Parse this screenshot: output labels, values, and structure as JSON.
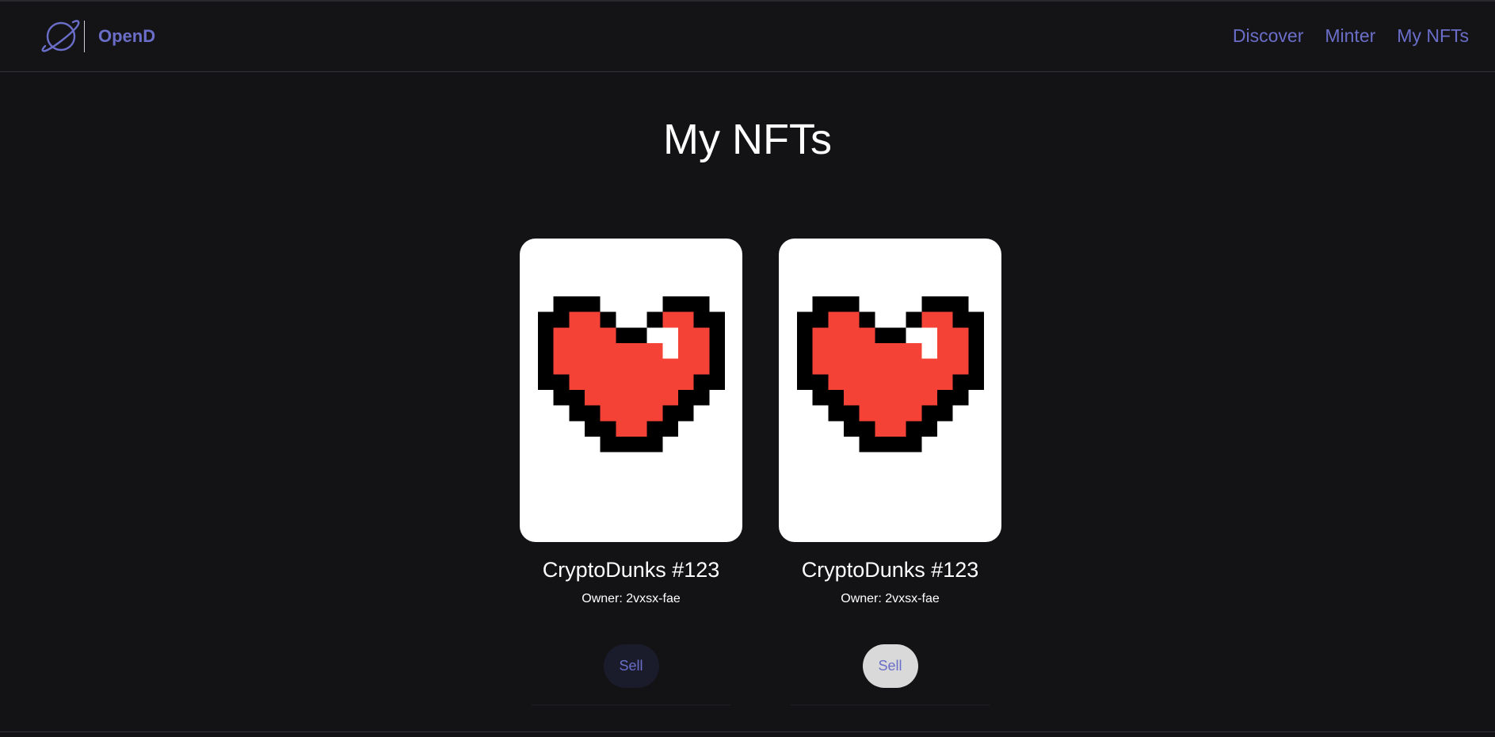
{
  "navbar": {
    "brand": "OpenD",
    "links": [
      "Discover",
      "Minter",
      "My NFTs"
    ],
    "accent_color": "#6a6ec9"
  },
  "page": {
    "title": "My NFTs"
  },
  "nfts": [
    {
      "name": "CryptoDunks #123",
      "owner": "Owner: 2vxsx-fae",
      "button": "Sell",
      "image_icon": "pixel-heart-icon"
    },
    {
      "name": "CryptoDunks #123",
      "owner": "Owner: 2vxsx-fae",
      "button": "Sell",
      "image_icon": "pixel-heart-icon"
    }
  ]
}
